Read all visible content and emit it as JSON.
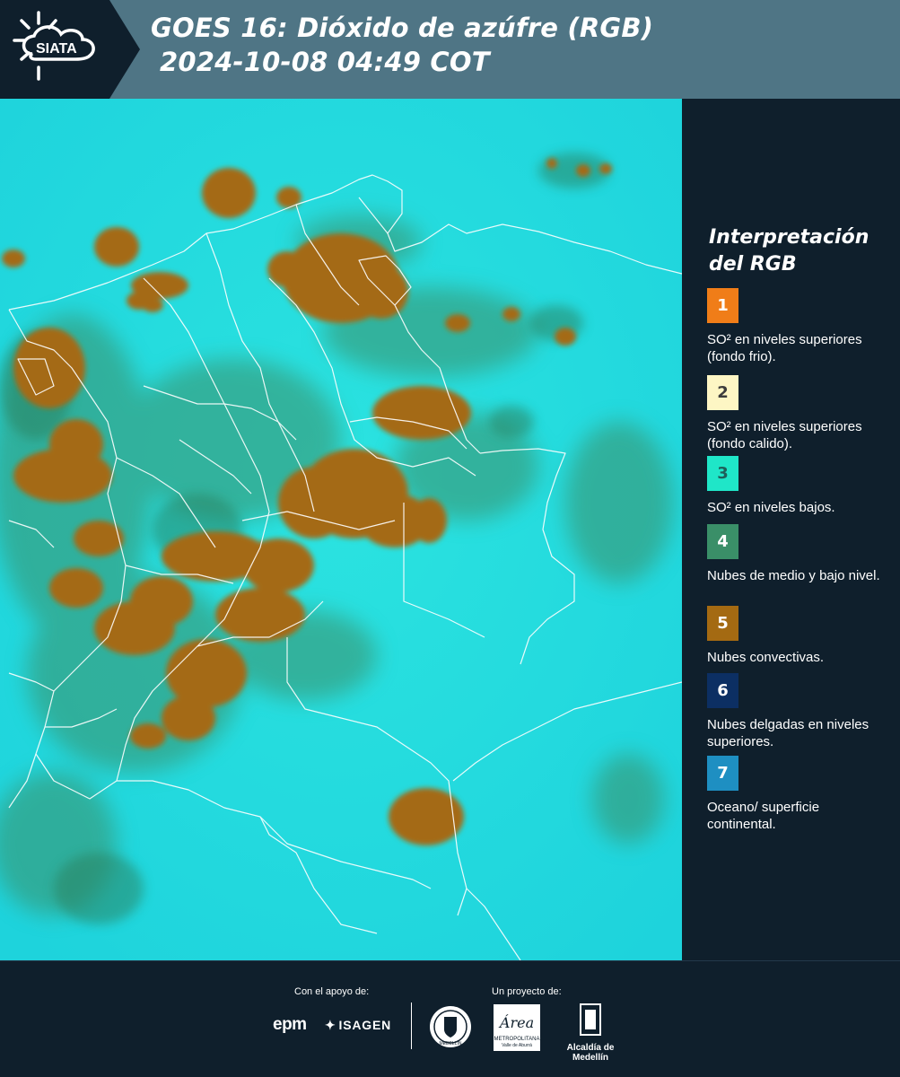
{
  "header": {
    "logo_text": "SIATA",
    "title_line1": "GOES 16: Dióxido de azúfre (RGB)",
    "title_line2": "2024-10-08 04:49 COT",
    "background_color": "#4f7585"
  },
  "legend": {
    "title": "Interpretación del RGB",
    "items": [
      {
        "number": "1",
        "label": "SO² en niveles superiores (fondo frio).",
        "color": "#f07d18"
      },
      {
        "number": "2",
        "label": "SO² en niveles superiores (fondo calido).",
        "color": "#fdf6c4"
      },
      {
        "number": "3",
        "label": "SO² en niveles bajos.",
        "color": "#1fe6c8"
      },
      {
        "number": "4",
        "label": "Nubes de medio y bajo nivel.",
        "color": "#3a8f68"
      },
      {
        "number": "5",
        "label": "Nubes convectivas.",
        "color": "#a46a12"
      },
      {
        "number": "6",
        "label": "Nubes delgadas en niveles superiores.",
        "color": "#0c2f63"
      },
      {
        "number": "7",
        "label": "Oceano/ superficie continental.",
        "color": "#1e8fc2"
      }
    ]
  },
  "footer": {
    "support_label": "Con el apoyo de:",
    "project_label": "Un proyecto de:",
    "sponsors": {
      "epm": "epm",
      "isagen": "ISAGEN"
    },
    "partners": {
      "area_name": "Área",
      "area_sub1": "METROPOLITANA",
      "area_sub2": "Valle de Aburrá",
      "alcaldia": "Alcaldía de Medellín",
      "seal_text": "MEDELLÍN"
    }
  },
  "colors": {
    "map_background": "#22d9dd",
    "panel_background": "#0f1f2c",
    "convective": "#a46a12",
    "low_cloud": "#3a8f68"
  }
}
